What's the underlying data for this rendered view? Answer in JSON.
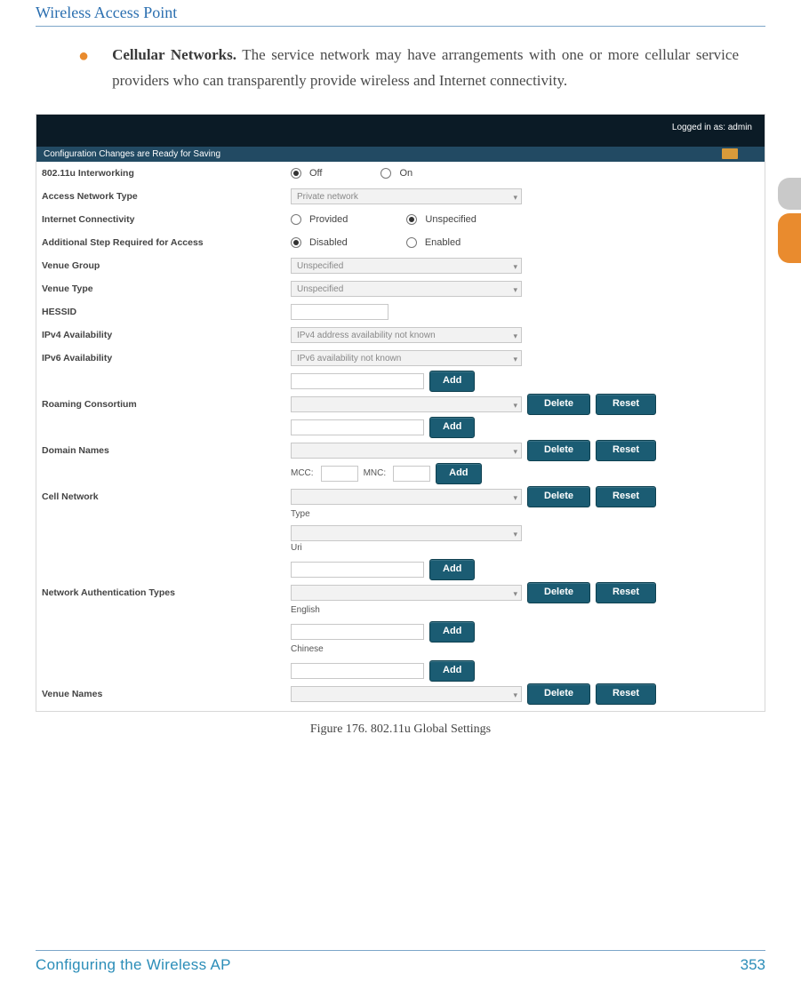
{
  "header": {
    "title": "Wireless Access Point"
  },
  "para": {
    "bold": "Cellular Networks.",
    "rest": " The service network may have arrangements with one or more cellular service providers who can transparently provide wireless and Internet connectivity."
  },
  "ss": {
    "login": "Logged in as: admin",
    "savebar": "Configuration Changes are Ready for Saving",
    "rows": {
      "interworking": "802.11u Interworking",
      "off": "Off",
      "on": "On",
      "ant": "Access Network Type",
      "ant_val": "Private network",
      "ic": "Internet Connectivity",
      "provided": "Provided",
      "unspecified": "Unspecified",
      "asra": "Additional Step Required for Access",
      "disabled": "Disabled",
      "enabled": "Enabled",
      "venue_group": "Venue Group",
      "unspec": "Unspecified",
      "venue_type": "Venue Type",
      "hessid": "HESSID",
      "ipv4": "IPv4 Availability",
      "ipv4_val": "IPv4 address availability not known",
      "ipv6": "IPv6 Availability",
      "ipv6_val": "IPv6 availability not known",
      "roaming": "Roaming Consortium",
      "domain": "Domain Names",
      "cell": "Cell Network",
      "mcc": "MCC:",
      "mnc": "MNC:",
      "nat": "Network Authentication Types",
      "type": "Type",
      "uri": "Uri",
      "venue_names": "Venue Names",
      "english": "English",
      "chinese": "Chinese"
    },
    "btn": {
      "add": "Add",
      "delete": "Delete",
      "reset": "Reset"
    }
  },
  "caption": "Figure 176. 802.11u Global Settings",
  "footer": {
    "left": "Configuring the Wireless AP",
    "right": "353"
  }
}
